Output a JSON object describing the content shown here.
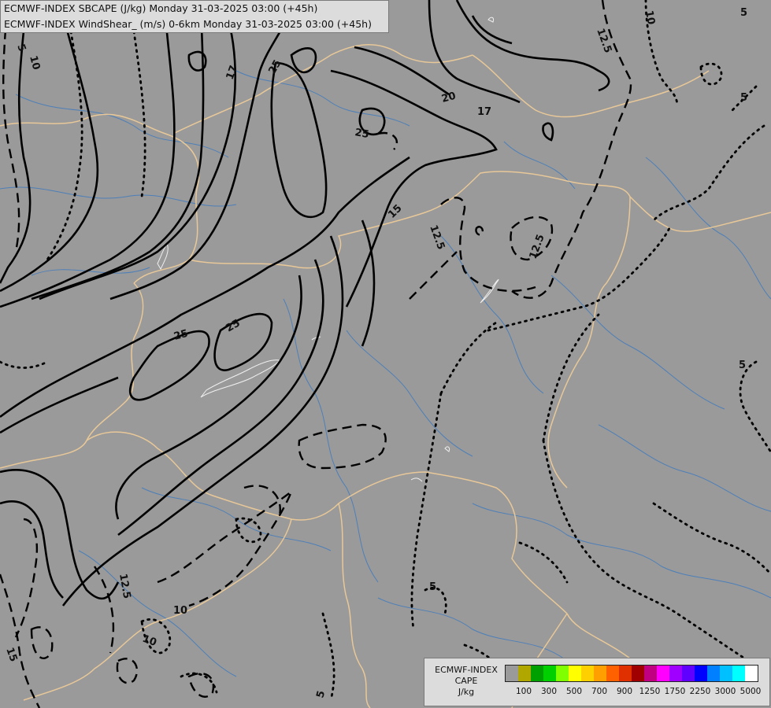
{
  "header": {
    "line1": "ECMWF-INDEX SBCAPE (J/kg) Monday 31-03-2025 03:00 (+45h)",
    "line2": "ECMWF-INDEX WindShear_ (m/s) 0-6km Monday 31-03-2025 03:00 (+45h)"
  },
  "legend": {
    "title_line1": "ECMWF-INDEX",
    "title_line2": "CAPE",
    "unit": "J/kg",
    "colors": [
      "#9a9a9a",
      "#b0a800",
      "#00a000",
      "#00d000",
      "#80ff00",
      "#ffff00",
      "#ffd000",
      "#ffa000",
      "#ff6000",
      "#e03000",
      "#a00000",
      "#c00080",
      "#ff00ff",
      "#a000ff",
      "#6000ff",
      "#0000ff",
      "#0080ff",
      "#00c0ff",
      "#00ffff",
      "#ffffff"
    ],
    "ticks": [
      "100",
      "300",
      "500",
      "700",
      "900",
      "1250",
      "1750",
      "2250",
      "3000",
      "5000"
    ]
  },
  "contour_labels": [
    "5",
    "10",
    "12.5",
    "15",
    "17",
    "20",
    "25"
  ],
  "map_labels": {
    "l_5a": "5",
    "l_10a": "10",
    "l_17a": "17",
    "l_25a": "25",
    "l_12_5a": "12.5",
    "l_10b": "10",
    "l_5b": "5",
    "l_25b": "25",
    "l_20a": "20",
    "l_17b": "17",
    "l_15a": "15",
    "l_12_5b": "12.5",
    "l_12_5c": "12.5",
    "l_5c": "5",
    "l_25c": "25",
    "l_25d": "25",
    "l_5d": "5",
    "l_12_5d": "12.5",
    "l_10c": "10",
    "l_10d": "10",
    "l_15b": "15",
    "l_5e": "5",
    "l_5f": "5"
  }
}
